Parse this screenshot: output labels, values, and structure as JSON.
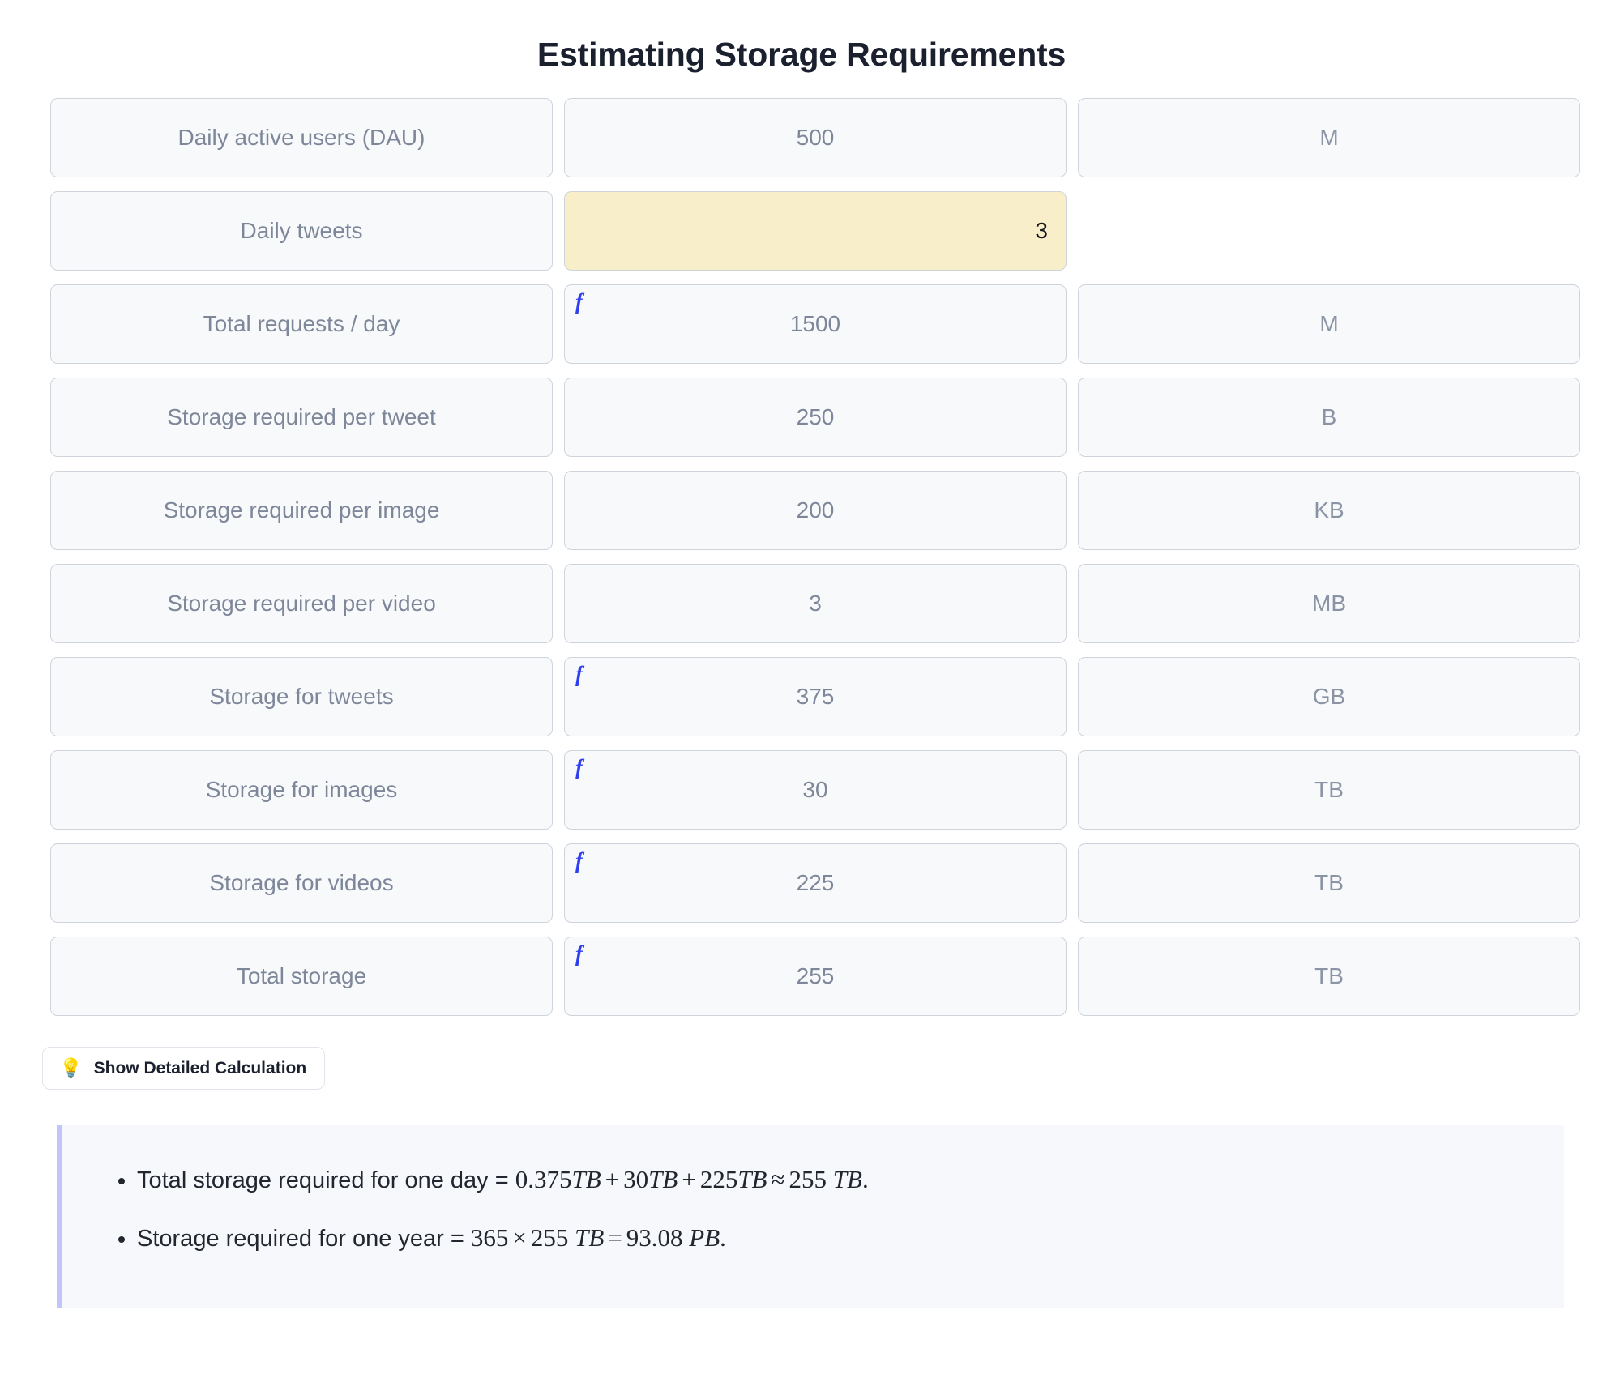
{
  "title": "Estimating Storage Requirements",
  "colors": {
    "accent_formula": "#2f3ff0",
    "input_highlight": "#f8eec9",
    "callout_border": "#c3c4f7",
    "callout_bg": "#f6f8fb",
    "cell_bg": "#f7f9fb",
    "cell_border": "#ced3dc",
    "label_text": "#7e879a",
    "title_text": "#1b202e",
    "bulb_orange": "#f0a03c"
  },
  "rows": [
    {
      "label": "Daily active users (DAU)",
      "value": "500",
      "unit": "M",
      "formula": false,
      "editable": false
    },
    {
      "label": "Daily tweets",
      "value": "3",
      "unit": "",
      "formula": false,
      "editable": true
    },
    {
      "label": "Total requests / day",
      "value": "1500",
      "unit": "M",
      "formula": true,
      "editable": false
    },
    {
      "label": "Storage required per tweet",
      "value": "250",
      "unit": "B",
      "formula": false,
      "editable": false
    },
    {
      "label": "Storage required per image",
      "value": "200",
      "unit": "KB",
      "formula": false,
      "editable": false
    },
    {
      "label": "Storage required per video",
      "value": "3",
      "unit": "MB",
      "formula": false,
      "editable": false
    },
    {
      "label": "Storage for tweets",
      "value": "375",
      "unit": "GB",
      "formula": true,
      "editable": false
    },
    {
      "label": "Storage for images",
      "value": "30",
      "unit": "TB",
      "formula": true,
      "editable": false
    },
    {
      "label": "Storage for videos",
      "value": "225",
      "unit": "TB",
      "formula": true,
      "editable": false
    },
    {
      "label": "Total storage",
      "value": "255",
      "unit": "TB",
      "formula": true,
      "editable": false
    }
  ],
  "formula_marker": "f",
  "toggle": {
    "icon": "lightbulb-icon",
    "glyph": "💡",
    "label": "Show Detailed Calculation"
  },
  "callout": {
    "bullets": [
      {
        "text": "Total storage required for one day = ",
        "math_plain": "0.375TB + 30TB + 225TB ≈ 255 TB.",
        "math_tokens": [
          {
            "t": "0.375",
            "k": "mn"
          },
          {
            "t": "TB",
            "k": "mi"
          },
          {
            "t": "+",
            "k": "mo"
          },
          {
            "t": "30",
            "k": "mn"
          },
          {
            "t": "TB",
            "k": "mi"
          },
          {
            "t": "+",
            "k": "mo"
          },
          {
            "t": "225",
            "k": "mn"
          },
          {
            "t": "TB",
            "k": "mi"
          },
          {
            "t": "≈",
            "k": "mo"
          },
          {
            "t": "255",
            "k": "mn"
          },
          {
            "t": " TB",
            "k": "mi"
          },
          {
            "t": ".",
            "k": "mn"
          }
        ]
      },
      {
        "text": "Storage required for one year = ",
        "math_plain": "365 × 255 TB = 93.08 PB.",
        "math_tokens": [
          {
            "t": "365",
            "k": "mn"
          },
          {
            "t": "×",
            "k": "mo"
          },
          {
            "t": "255",
            "k": "mn"
          },
          {
            "t": " TB",
            "k": "mi"
          },
          {
            "t": "=",
            "k": "mo"
          },
          {
            "t": "93.08",
            "k": "mn"
          },
          {
            "t": " PB",
            "k": "mi"
          },
          {
            "t": ".",
            "k": "mn"
          }
        ]
      }
    ]
  }
}
